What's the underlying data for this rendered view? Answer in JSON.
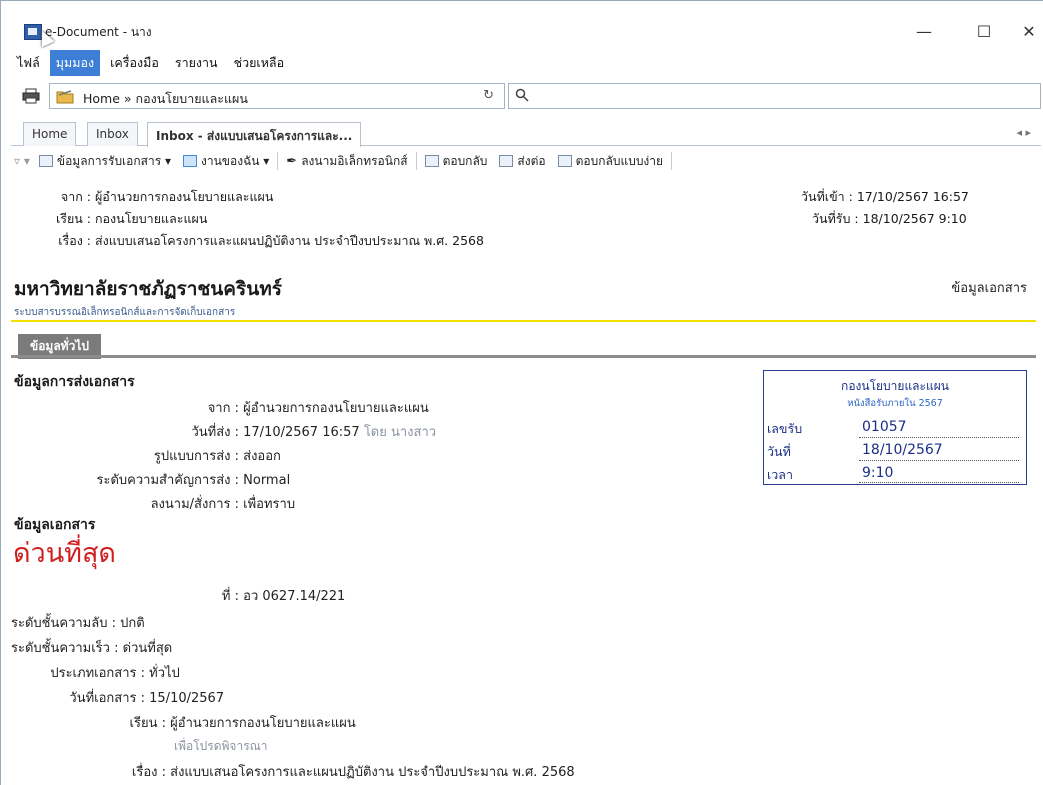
{
  "window": {
    "title": "e-Document - นาง",
    "minimize": "—",
    "maximize": "☐",
    "close": "✕"
  },
  "menu": {
    "items": [
      "ไฟล์",
      "มุมมอง",
      "เครื่องมือ",
      "รายงาน",
      "ช่วยเหลือ"
    ],
    "active_index": 1
  },
  "address": {
    "path": "Home » กองนโยบายและแผน",
    "search_placeholder": ""
  },
  "tabs": [
    "Home",
    "Inbox",
    "Inbox - ส่งแบบเสนอโครงการและ..."
  ],
  "toolbar": {
    "receive_info": "ข้อมูลการรับเอกสาร",
    "my_tasks": "งานของฉัน",
    "e_signature": "ลงนามอิเล็กทรอนิกส์",
    "reply": "ตอบกลับ",
    "forward": "ส่งต่อ",
    "quick_reply": "ตอบกลับแบบง่าย"
  },
  "message_header": {
    "from_label": "จาก :",
    "from": "ผู้อำนวยการกองนโยบายและแผน",
    "to_label": "เรียน :",
    "to": "กองนโยบายและแผน",
    "subject_label": "เรื่อง :",
    "subject": "ส่งแบบเสนอโครงการและแผนปฏิบัติงาน ประจำปีงบประมาณ พ.ศ. 2568",
    "in_date_label": "วันที่เข้า :",
    "in_date": "17/10/2567 16:57",
    "recv_date_label": "วันที่รับ :",
    "recv_date": "18/10/2567 9:10"
  },
  "document": {
    "org_title": "มหาวิทยาลัยราชภัฏราชนครินทร์",
    "system_subtitle": "ระบบสารบรรณอิเล็กทรอนิกส์และการจัดเก็บเอกสาร",
    "doc_info_label": "ข้อมูลเอกสาร",
    "general_tab": "ข้อมูลทั่วไป"
  },
  "send_info": {
    "heading": "ข้อมูลการส่งเอกสาร",
    "from_label": "จาก :",
    "from": "ผู้อำนวยการกองนโยบายและแผน",
    "sent_date_label": "วันที่ส่ง :",
    "sent_date": "17/10/2567 16:57",
    "sent_by": "โดย นางสาว",
    "method_label": "รูปแบบการส่ง :",
    "method": "ส่งออก",
    "priority_label": "ระดับความสำคัญการส่ง :",
    "priority": "Normal",
    "order_label": "ลงนาม/สั่งการ :",
    "order": "เพื่อทราบ"
  },
  "doc_info": {
    "heading": "ข้อมูลเอกสาร",
    "urgency": "ด่วนที่สุด",
    "number_label": "ที่ :",
    "number": "อว 0627.14/221",
    "secrecy_label": "ระดับชั้นความลับ :",
    "secrecy": "ปกติ",
    "speed_label": "ระดับชั้นความเร็ว :",
    "speed": "ด่วนที่สุด",
    "type_label": "ประเภทเอกสาร :",
    "type": "ทั่วไป",
    "date_label": "วันที่เอกสาร :",
    "date": "15/10/2567",
    "to_label": "เรียน :",
    "to": "ผู้อำนวยการกองนโยบายและแผน",
    "to_note": "เพื่อโปรดพิจารณา",
    "subject_label": "เรื่อง :",
    "subject": "ส่งแบบเสนอโครงการและแผนปฏิบัติงาน ประจำปีงบประมาณ พ.ศ. 2568"
  },
  "receipt": {
    "org": "กองนโยบายและแผน",
    "subtitle": "หนังสือรับภายใน 2567",
    "number_label": "เลขรับ",
    "number": "01057",
    "date_label": "วันที่",
    "date": "18/10/2567",
    "time_label": "เวลา",
    "time": "9:10"
  }
}
